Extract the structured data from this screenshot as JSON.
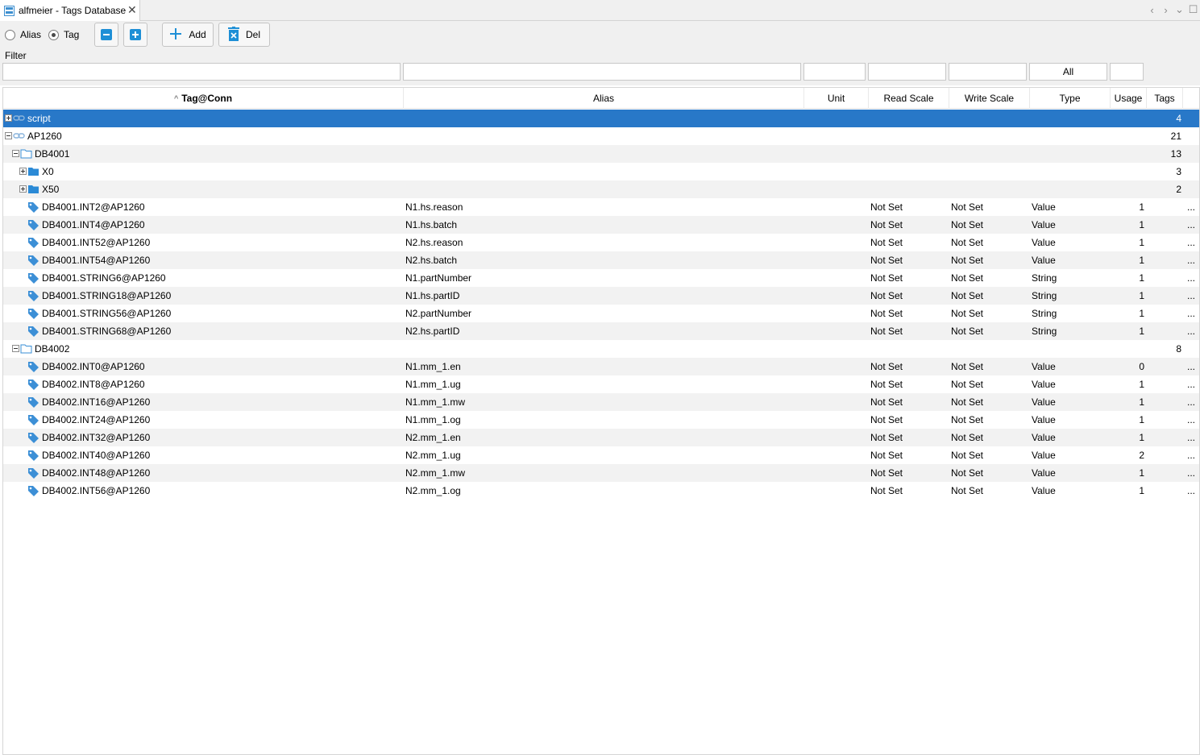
{
  "tab": {
    "title": "alfmeier - Tags Database",
    "close": "✕"
  },
  "window_controls": {
    "prev": "‹",
    "next": "›",
    "menu": "⌄",
    "maximize": "☐"
  },
  "toolbar": {
    "alias_label": "Alias",
    "tag_label": "Tag",
    "selected_mode": "Tag",
    "add_label": "Add",
    "del_label": "Del"
  },
  "filter": {
    "label": "Filter",
    "tag_value": "",
    "alias_value": "",
    "unit_value": "",
    "read_scale_value": "",
    "write_scale_value": "",
    "type_value": "All",
    "usage_value": ""
  },
  "columns": {
    "tag": "Tag@Conn",
    "alias": "Alias",
    "unit": "Unit",
    "read_scale": "Read Scale",
    "write_scale": "Write Scale",
    "type": "Type",
    "usage": "Usage",
    "tags": "Tags"
  },
  "colors": {
    "selection": "#2878c8",
    "icon_blue": "#1e8fd6"
  },
  "rows": [
    {
      "kind": "conn",
      "level": 0,
      "expanded": false,
      "name": "script",
      "tags": "4",
      "selected": true
    },
    {
      "kind": "conn",
      "level": 0,
      "expanded": true,
      "name": "AP1260",
      "tags": "21"
    },
    {
      "kind": "folder",
      "level": 1,
      "expanded": true,
      "name": "DB4001",
      "tags": "13"
    },
    {
      "kind": "folder-filled",
      "level": 2,
      "expanded": false,
      "name": "X0",
      "tags": "3"
    },
    {
      "kind": "folder-filled",
      "level": 2,
      "expanded": false,
      "name": "X50",
      "tags": "2"
    },
    {
      "kind": "tag",
      "level": 3,
      "name": "DB4001.INT2@AP1260",
      "alias": "N1.hs.reason",
      "read": "Not Set",
      "write": "Not Set",
      "type": "Value",
      "usage": "1",
      "more": "..."
    },
    {
      "kind": "tag",
      "level": 3,
      "name": "DB4001.INT4@AP1260",
      "alias": "N1.hs.batch",
      "read": "Not Set",
      "write": "Not Set",
      "type": "Value",
      "usage": "1",
      "more": "..."
    },
    {
      "kind": "tag",
      "level": 3,
      "name": "DB4001.INT52@AP1260",
      "alias": "N2.hs.reason",
      "read": "Not Set",
      "write": "Not Set",
      "type": "Value",
      "usage": "1",
      "more": "..."
    },
    {
      "kind": "tag",
      "level": 3,
      "name": "DB4001.INT54@AP1260",
      "alias": "N2.hs.batch",
      "read": "Not Set",
      "write": "Not Set",
      "type": "Value",
      "usage": "1",
      "more": "..."
    },
    {
      "kind": "tag",
      "level": 3,
      "name": "DB4001.STRING6@AP1260",
      "alias": "N1.partNumber",
      "read": "Not Set",
      "write": "Not Set",
      "type": "String",
      "usage": "1",
      "more": "..."
    },
    {
      "kind": "tag",
      "level": 3,
      "name": "DB4001.STRING18@AP1260",
      "alias": "N1.hs.partID",
      "read": "Not Set",
      "write": "Not Set",
      "type": "String",
      "usage": "1",
      "more": "..."
    },
    {
      "kind": "tag",
      "level": 3,
      "name": "DB4001.STRING56@AP1260",
      "alias": "N2.partNumber",
      "read": "Not Set",
      "write": "Not Set",
      "type": "String",
      "usage": "1",
      "more": "..."
    },
    {
      "kind": "tag",
      "level": 3,
      "name": "DB4001.STRING68@AP1260",
      "alias": "N2.hs.partID",
      "read": "Not Set",
      "write": "Not Set",
      "type": "String",
      "usage": "1",
      "more": "..."
    },
    {
      "kind": "folder",
      "level": 1,
      "expanded": true,
      "name": "DB4002",
      "tags": "8"
    },
    {
      "kind": "tag",
      "level": 3,
      "name": "DB4002.INT0@AP1260",
      "alias": "N1.mm_1.en",
      "read": "Not Set",
      "write": "Not Set",
      "type": "Value",
      "usage": "0",
      "more": "..."
    },
    {
      "kind": "tag",
      "level": 3,
      "name": "DB4002.INT8@AP1260",
      "alias": "N1.mm_1.ug",
      "read": "Not Set",
      "write": "Not Set",
      "type": "Value",
      "usage": "1",
      "more": "..."
    },
    {
      "kind": "tag",
      "level": 3,
      "name": "DB4002.INT16@AP1260",
      "alias": "N1.mm_1.mw",
      "read": "Not Set",
      "write": "Not Set",
      "type": "Value",
      "usage": "1",
      "more": "..."
    },
    {
      "kind": "tag",
      "level": 3,
      "name": "DB4002.INT24@AP1260",
      "alias": "N1.mm_1.og",
      "read": "Not Set",
      "write": "Not Set",
      "type": "Value",
      "usage": "1",
      "more": "..."
    },
    {
      "kind": "tag",
      "level": 3,
      "name": "DB4002.INT32@AP1260",
      "alias": "N2.mm_1.en",
      "read": "Not Set",
      "write": "Not Set",
      "type": "Value",
      "usage": "1",
      "more": "..."
    },
    {
      "kind": "tag",
      "level": 3,
      "name": "DB4002.INT40@AP1260",
      "alias": "N2.mm_1.ug",
      "read": "Not Set",
      "write": "Not Set",
      "type": "Value",
      "usage": "2",
      "more": "..."
    },
    {
      "kind": "tag",
      "level": 3,
      "name": "DB4002.INT48@AP1260",
      "alias": "N2.mm_1.mw",
      "read": "Not Set",
      "write": "Not Set",
      "type": "Value",
      "usage": "1",
      "more": "..."
    },
    {
      "kind": "tag",
      "level": 3,
      "name": "DB4002.INT56@AP1260",
      "alias": "N2.mm_1.og",
      "read": "Not Set",
      "write": "Not Set",
      "type": "Value",
      "usage": "1",
      "more": "..."
    }
  ]
}
